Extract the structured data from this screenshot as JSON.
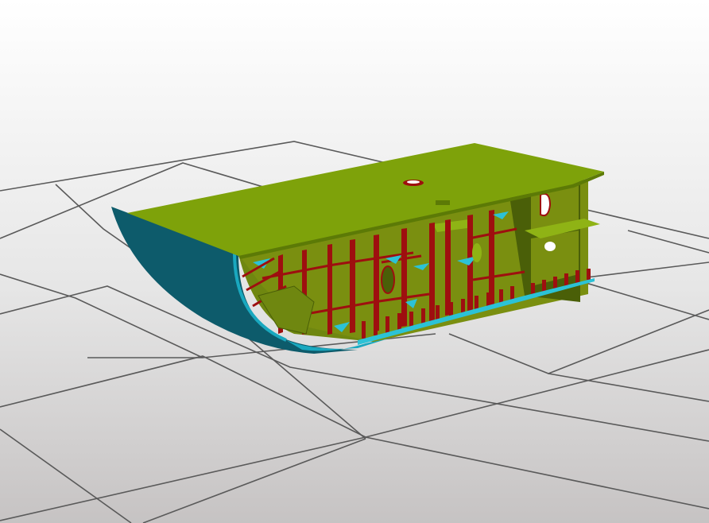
{
  "viewport": {
    "background_top": "#ffffff",
    "background_bottom": "#c6c3c3",
    "grid_color": "#5a5a5a"
  },
  "model": {
    "colors": {
      "deck_plate": "#7ea20a",
      "bulkhead": "#7a8f10",
      "bulkhead_dark": "#4a5f08",
      "shell_plate": "#0d5b6b",
      "shell_plate_light": "#1aa8bf",
      "stiffeners": "#9e0f0f",
      "brackets": "#2cc2d6"
    }
  }
}
